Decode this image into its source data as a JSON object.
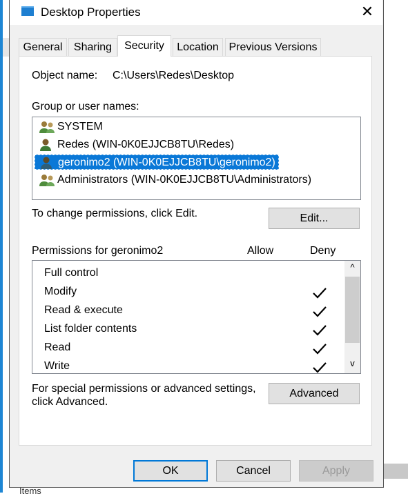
{
  "window": {
    "title": "Desktop Properties"
  },
  "tabs": [
    {
      "label": "General"
    },
    {
      "label": "Sharing"
    },
    {
      "label": "Security"
    },
    {
      "label": "Location"
    },
    {
      "label": "Previous Versions"
    }
  ],
  "active_tab": "Security",
  "object": {
    "label": "Object name:",
    "value": "C:\\Users\\Redes\\Desktop"
  },
  "groups": {
    "label": "Group or user names:",
    "items": [
      {
        "name": "SYSTEM",
        "icon": "group-icon"
      },
      {
        "name": "Redes (WIN-0K0EJJCB8TU\\Redes)",
        "icon": "user-icon"
      },
      {
        "name": "geronimo2 (WIN-0K0EJJCB8TU\\geronimo2)",
        "icon": "user-icon",
        "selected": true
      },
      {
        "name": "Administrators (WIN-0K0EJJCB8TU\\Administrators)",
        "icon": "group-icon"
      }
    ]
  },
  "change_hint": "To change permissions, click Edit.",
  "edit_button": "Edit...",
  "permissions": {
    "header": "Permissions for geronimo2",
    "allow_label": "Allow",
    "deny_label": "Deny",
    "items": [
      {
        "name": "Full control",
        "allow": false,
        "deny": false
      },
      {
        "name": "Modify",
        "allow": false,
        "deny": true
      },
      {
        "name": "Read & execute",
        "allow": false,
        "deny": true
      },
      {
        "name": "List folder contents",
        "allow": false,
        "deny": true
      },
      {
        "name": "Read",
        "allow": false,
        "deny": true
      },
      {
        "name": "Write",
        "allow": false,
        "deny": true
      }
    ]
  },
  "special": {
    "line1": "For special permissions or advanced settings,",
    "line2": "click Advanced."
  },
  "advanced_button": "Advanced",
  "footer": {
    "ok": "OK",
    "cancel": "Cancel",
    "apply": "Apply"
  },
  "background": {
    "partial_text": "Items"
  },
  "colors": {
    "selection": "#0a78d7",
    "accent": "#0078d7",
    "taskbar": "#1e86d4"
  }
}
